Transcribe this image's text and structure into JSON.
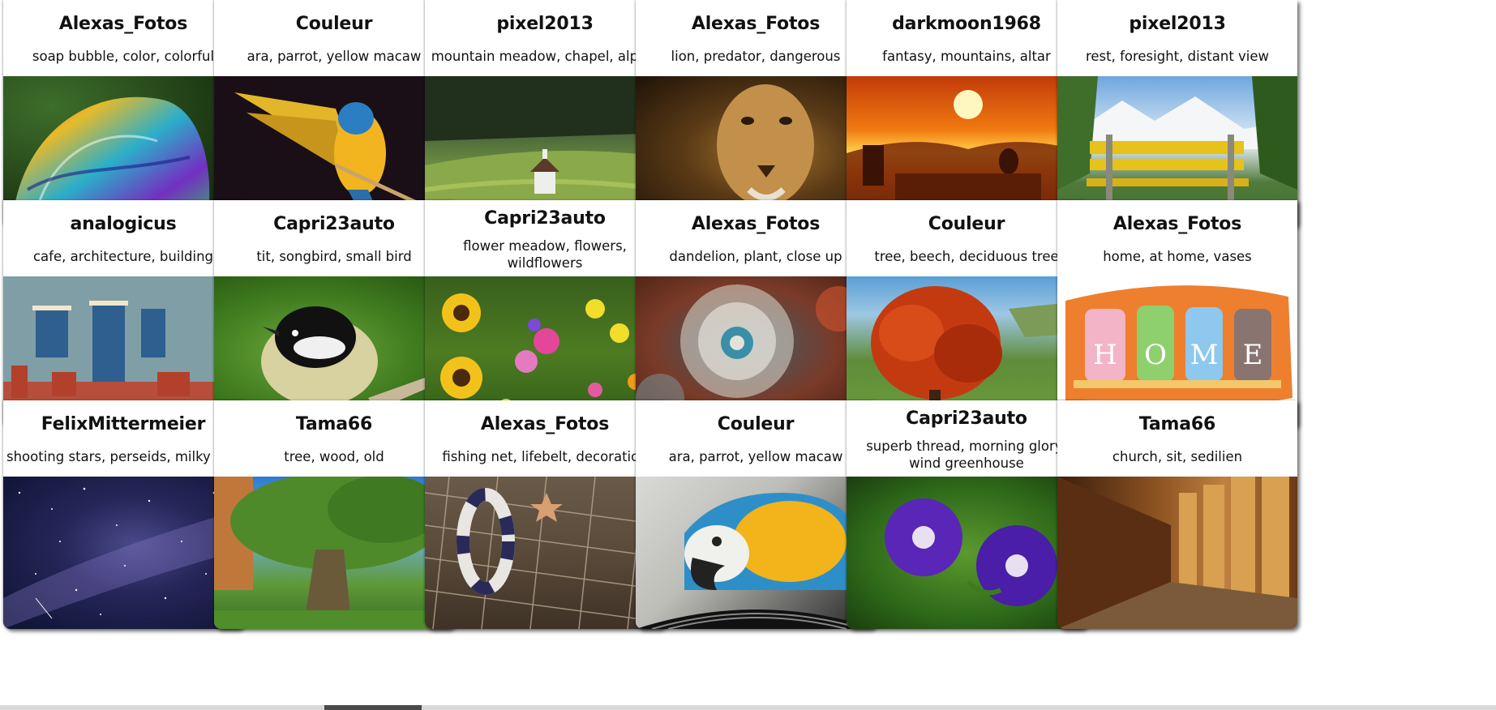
{
  "gallery": {
    "cards": [
      {
        "author": "Alexas_Fotos",
        "tags": "soap bubble, color, colorful",
        "image": "soap-bubble-photo"
      },
      {
        "author": "Couleur",
        "tags": "ara, parrot, yellow macaw",
        "image": "macaw-flying-photo"
      },
      {
        "author": "pixel2013",
        "tags": "mountain meadow, chapel, alpine",
        "image": "alpine-chapel-photo"
      },
      {
        "author": "Alexas_Fotos",
        "tags": "lion, predator, dangerous",
        "image": "lion-photo"
      },
      {
        "author": "darkmoon1968",
        "tags": "fantasy, mountains, altar",
        "image": "sunset-altar-photo"
      },
      {
        "author": "pixel2013",
        "tags": "rest, foresight, distant view",
        "image": "bench-view-photo"
      },
      {
        "author": "analogicus",
        "tags": "cafe, architecture, building",
        "image": "cafe-building-photo"
      },
      {
        "author": "Capri23auto",
        "tags": "tit, songbird, small bird",
        "image": "tit-bird-photo"
      },
      {
        "author": "Capri23auto",
        "tags": "flower meadow, flowers, wildflowers",
        "image": "flower-meadow-photo"
      },
      {
        "author": "Alexas_Fotos",
        "tags": "dandelion, plant, close up",
        "image": "dandelion-photo"
      },
      {
        "author": "Couleur",
        "tags": "tree, beech, deciduous tree",
        "image": "red-beech-photo"
      },
      {
        "author": "Alexas_Fotos",
        "tags": "home, at home, vases",
        "image": "home-vases-photo"
      },
      {
        "author": "FelixMittermeier",
        "tags": "shooting stars, perseids, milky way",
        "image": "milky-way-photo"
      },
      {
        "author": "Tama66",
        "tags": "tree, wood, old",
        "image": "old-tree-photo"
      },
      {
        "author": "Alexas_Fotos",
        "tags": "fishing net, lifebelt, decoration",
        "image": "fishing-net-photo"
      },
      {
        "author": "Couleur",
        "tags": "ara, parrot, yellow macaw",
        "image": "macaw-closeup-photo"
      },
      {
        "author": "Capri23auto",
        "tags": "superb thread, morning glory, wind greenhouse",
        "image": "morning-glory-photo"
      },
      {
        "author": "Tama66",
        "tags": "church, sit, sedilien",
        "image": "church-stalls-photo"
      }
    ],
    "vase_letters": [
      "H",
      "O",
      "M",
      "E"
    ]
  }
}
